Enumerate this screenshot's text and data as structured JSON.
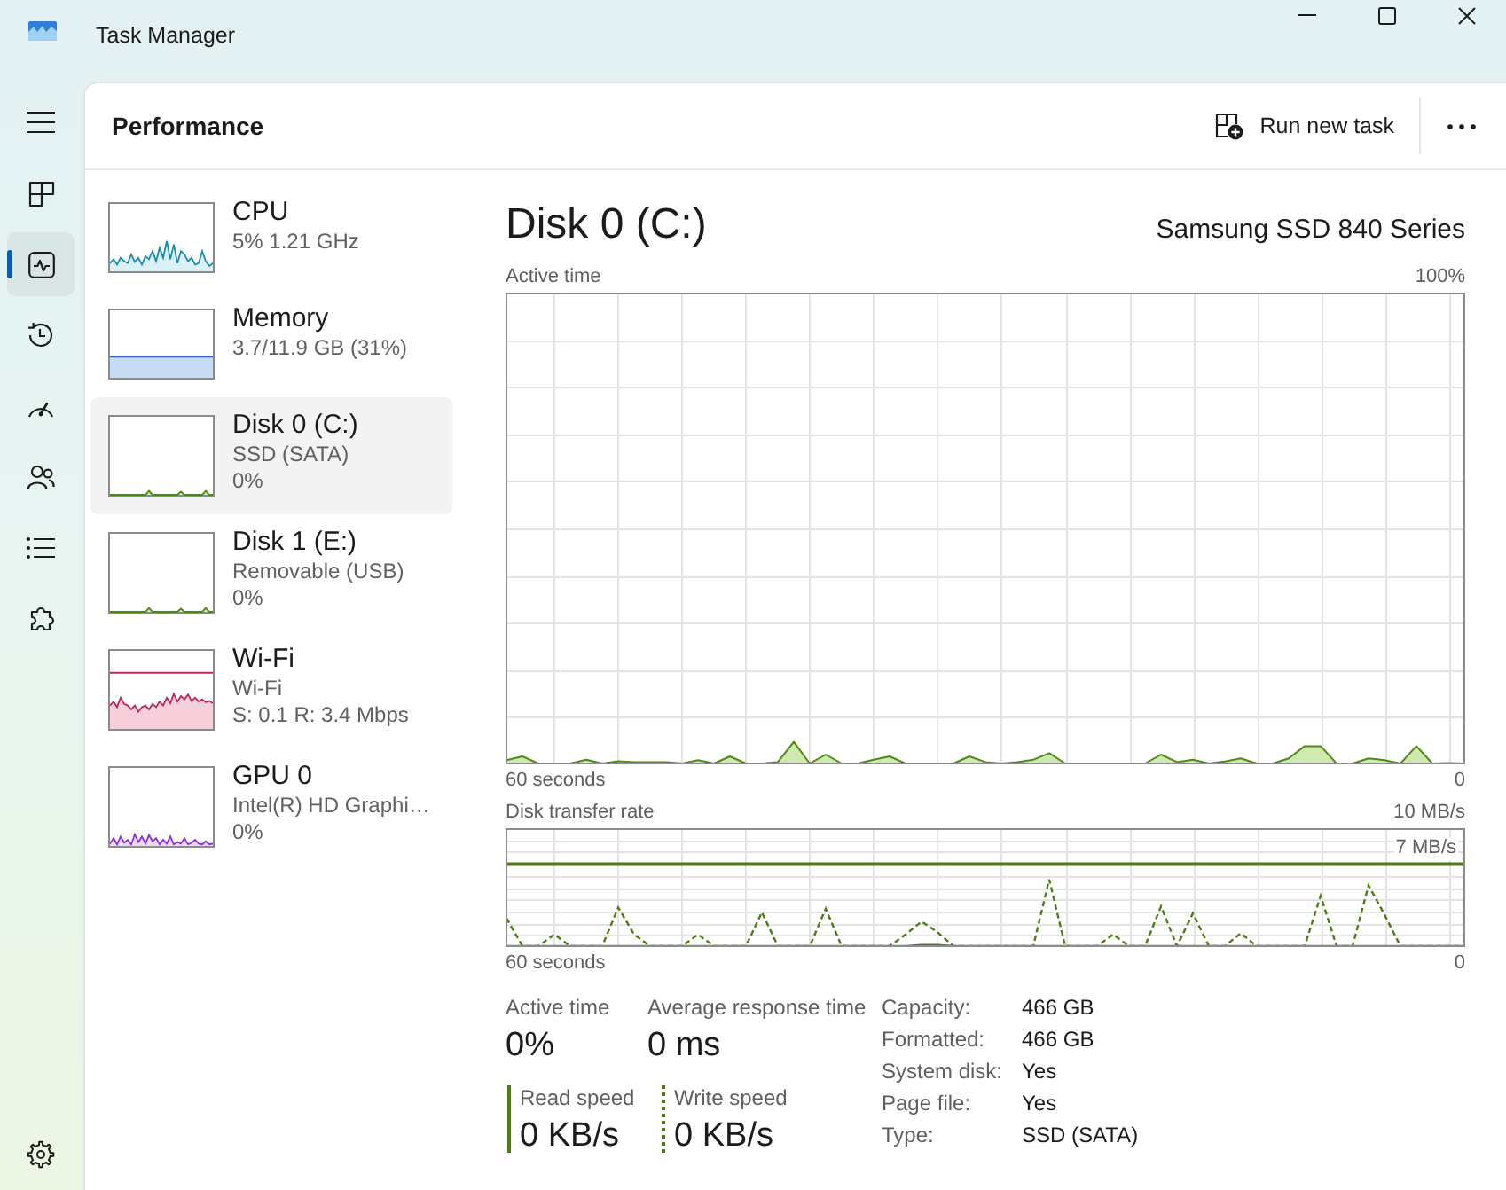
{
  "window": {
    "title": "Task Manager"
  },
  "nav": [
    {
      "kind": "processes",
      "selected": false
    },
    {
      "kind": "performance",
      "selected": true
    },
    {
      "kind": "app_history",
      "selected": false
    },
    {
      "kind": "startup",
      "selected": false
    },
    {
      "kind": "users",
      "selected": false
    },
    {
      "kind": "details",
      "selected": false
    },
    {
      "kind": "services",
      "selected": false
    }
  ],
  "header": {
    "title": "Performance",
    "action": "Run new task"
  },
  "devices": [
    {
      "kind": "cpu",
      "name": "CPU",
      "details": [
        "5% 1.21 GHz"
      ],
      "selected": false
    },
    {
      "kind": "memory",
      "name": "Memory",
      "details": [
        "3.7/11.9 GB (31%)"
      ],
      "selected": false
    },
    {
      "kind": "disk",
      "name": "Disk 0 (C:)",
      "details": [
        "SSD (SATA)",
        "0%"
      ],
      "selected": true
    },
    {
      "kind": "disk",
      "name": "Disk 1 (E:)",
      "details": [
        "Removable (USB)",
        "0%"
      ],
      "selected": false
    },
    {
      "kind": "network",
      "name": "Wi-Fi",
      "details": [
        "Wi-Fi",
        "S: 0.1 R: 3.4 Mbps"
      ],
      "selected": false
    },
    {
      "kind": "gpu",
      "name": "GPU 0",
      "details": [
        "Intel(R) HD Graphi…",
        "0%"
      ],
      "selected": false
    }
  ],
  "detail": {
    "title": "Disk 0 (C:)",
    "model": "Samsung SSD 840 Series",
    "graphs": [
      {
        "kind": "active_time",
        "title": "Active time",
        "max_label": "100%",
        "span_label": "60 seconds",
        "min_label": "0"
      },
      {
        "kind": "transfer_rate",
        "title": "Disk transfer rate",
        "max_label": "10 MB/s",
        "reference_label": "7 MB/s",
        "span_label": "60 seconds",
        "min_label": "0"
      }
    ],
    "stats": [
      {
        "label": "Active time",
        "value": "0%"
      },
      {
        "label": "Average response time",
        "value": "0 ms"
      }
    ],
    "speeds": [
      {
        "label": "Read speed",
        "value": "0 KB/s"
      },
      {
        "label": "Write speed",
        "value": "0 KB/s"
      }
    ],
    "properties": [
      {
        "label": "Capacity:",
        "value": "466 GB"
      },
      {
        "label": "Formatted:",
        "value": "466 GB"
      },
      {
        "label": "System disk:",
        "value": "Yes"
      },
      {
        "label": "Page file:",
        "value": "Yes"
      },
      {
        "label": "Type:",
        "value": "SSD (SATA)"
      }
    ]
  }
}
